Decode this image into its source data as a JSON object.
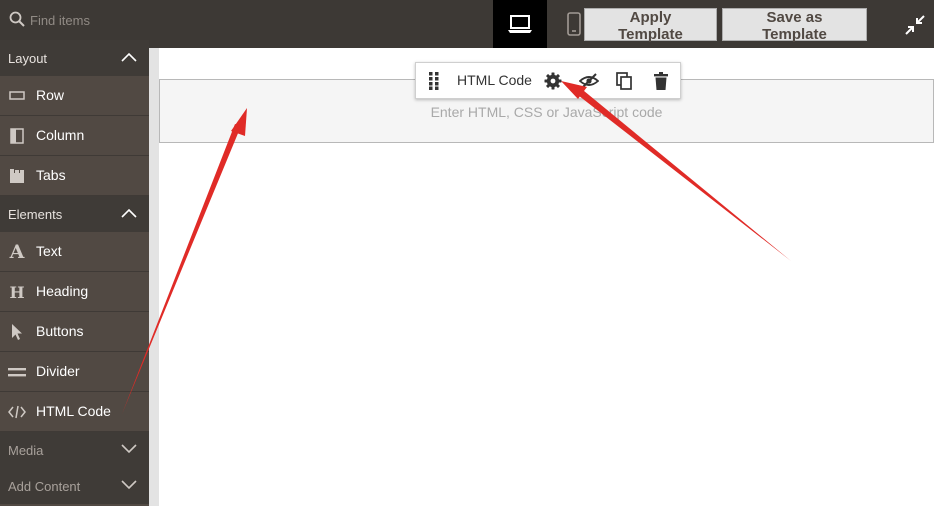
{
  "search": {
    "placeholder": "Find items",
    "icon": "search-icon"
  },
  "header": {
    "device_desktop_icon": "laptop-icon",
    "device_mobile_icon": "mobile-icon",
    "apply_template_label": "Apply Template",
    "save_template_label": "Save as Template",
    "fullscreen_icon": "collapse-icon"
  },
  "sidebar": {
    "groups": [
      {
        "label": "Layout",
        "state": "expanded",
        "items": [
          {
            "label": "Row",
            "icon": "row-icon"
          },
          {
            "label": "Column",
            "icon": "column-icon"
          },
          {
            "label": "Tabs",
            "icon": "tabs-icon"
          }
        ]
      },
      {
        "label": "Elements",
        "state": "expanded",
        "items": [
          {
            "label": "Text",
            "icon": "text-icon"
          },
          {
            "label": "Heading",
            "icon": "heading-icon"
          },
          {
            "label": "Buttons",
            "icon": "cursor-icon"
          },
          {
            "label": "Divider",
            "icon": "divider-icon"
          },
          {
            "label": "HTML Code",
            "icon": "code-icon"
          }
        ]
      },
      {
        "label": "Media",
        "state": "collapsed",
        "items": []
      },
      {
        "label": "Add Content",
        "state": "collapsed",
        "items": []
      }
    ]
  },
  "stage": {
    "html_placeholder": "Enter HTML, CSS or JavaScript code",
    "toolbar": {
      "title": "HTML Code",
      "icons": [
        "drag-handle-icon",
        "gear-icon",
        "hide-icon",
        "duplicate-icon",
        "trash-icon"
      ]
    }
  },
  "colors": {
    "topbar": "#3d3935",
    "sidebar": "#514943",
    "sidebar_header": "#3f3b37",
    "annotation_arrow": "#e02b27"
  }
}
